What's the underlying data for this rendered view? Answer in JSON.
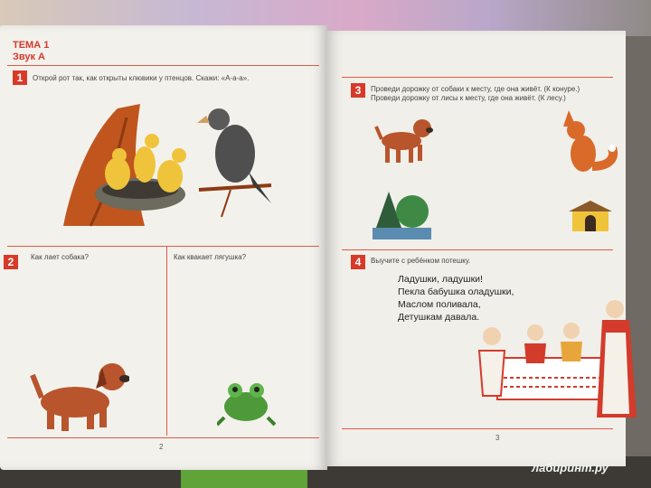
{
  "left_page": {
    "topic_title": "ТЕМА 1",
    "topic_sound": "Звук А",
    "task1": {
      "num": "1",
      "text": "Открой рот так, как открыты клювики у птенцов. Скажи: «А-а-а»."
    },
    "task2": {
      "num": "2",
      "q1": "Как лает собака?",
      "q2": "Как квакает лягушка?"
    },
    "page_number": "2"
  },
  "right_page": {
    "task3": {
      "num": "3",
      "line1": "Проведи дорожку от собаки к месту, где она живёт. (К конуре.)",
      "line2": "Проведи дорожку от лисы к месту, где она живёт. (К лесу.)"
    },
    "task4": {
      "num": "4",
      "text": "Выучите с ребёнком потешку.",
      "poem": [
        "Ладушки, ладушки!",
        "Пекла бабушка оладушки,",
        "Маслом поливала,",
        "Детушкам давала."
      ]
    },
    "page_number": "3"
  },
  "watermark": {
    "logo_text": "лабиринт.ру"
  },
  "colors": {
    "accent_red": "#d83a2a",
    "paper": "#f3f1ec"
  }
}
